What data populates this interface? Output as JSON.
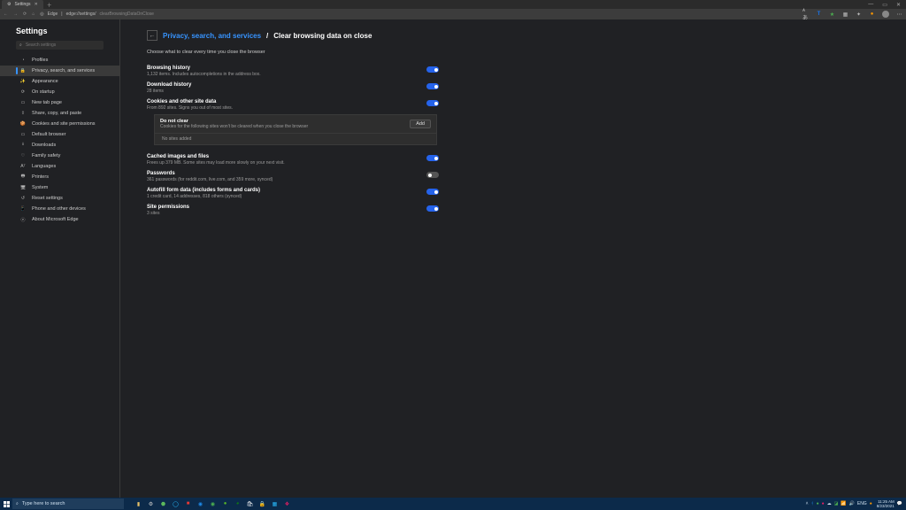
{
  "window": {
    "tab_title": "Settings"
  },
  "toolbar": {
    "prefix": "Edge",
    "url_bold": "edge://settings/",
    "url_rest": "clearBrowsingDataOnClose"
  },
  "sidebar": {
    "title": "Settings",
    "search_placeholder": "Search settings",
    "items": [
      {
        "icon": "◔",
        "label": "Profiles"
      },
      {
        "icon": "🔒",
        "label": "Privacy, search, and services"
      },
      {
        "icon": "✨",
        "label": "Appearance"
      },
      {
        "icon": "⟳",
        "label": "On startup"
      },
      {
        "icon": "▭",
        "label": "New tab page"
      },
      {
        "icon": "⇪",
        "label": "Share, copy, and paste"
      },
      {
        "icon": "🍪",
        "label": "Cookies and site permissions"
      },
      {
        "icon": "▭",
        "label": "Default browser"
      },
      {
        "icon": "⭳",
        "label": "Downloads"
      },
      {
        "icon": "♡",
        "label": "Family safety"
      },
      {
        "icon": "Aᵀ",
        "label": "Languages"
      },
      {
        "icon": "🖶",
        "label": "Printers"
      },
      {
        "icon": "🖥",
        "label": "System"
      },
      {
        "icon": "↺",
        "label": "Reset settings"
      },
      {
        "icon": "📱",
        "label": "Phone and other devices"
      },
      {
        "icon": "ⓔ",
        "label": "About Microsoft Edge"
      }
    ]
  },
  "breadcrumb": {
    "link": "Privacy, search, and services",
    "current": "Clear browsing data on close"
  },
  "subtitle": "Choose what to clear every time you close the browser",
  "options": [
    {
      "title": "Browsing history",
      "desc": "1,132 items. Includes autocompletions in the address box.",
      "on": true
    },
    {
      "title": "Download history",
      "desc": "28 items",
      "on": true
    },
    {
      "title": "Cookies and other site data",
      "desc": "From 892 sites. Signs you out of most sites.",
      "on": true
    },
    {
      "title": "Cached images and files",
      "desc": "Frees up 379 MB. Some sites may load more slowly on your next visit.",
      "on": true
    },
    {
      "title": "Passwords",
      "desc": "361 passwords (for reddit.com, live.com, and 359 more, synced)",
      "on": false
    },
    {
      "title": "Autofill form data (includes forms and cards)",
      "desc": "1 credit card, 14 addresses, 818 others (synced)",
      "on": true
    },
    {
      "title": "Site permissions",
      "desc": "3 sites",
      "on": true
    }
  ],
  "do_not_clear": {
    "title": "Do not clear",
    "desc": "Cookies for the following sites won't be cleared when you close the browser",
    "add": "Add",
    "empty": "No sites added"
  },
  "taskbar": {
    "search_placeholder": "Type here to search",
    "time": "11:25 AM",
    "date": "8/23/2021"
  }
}
